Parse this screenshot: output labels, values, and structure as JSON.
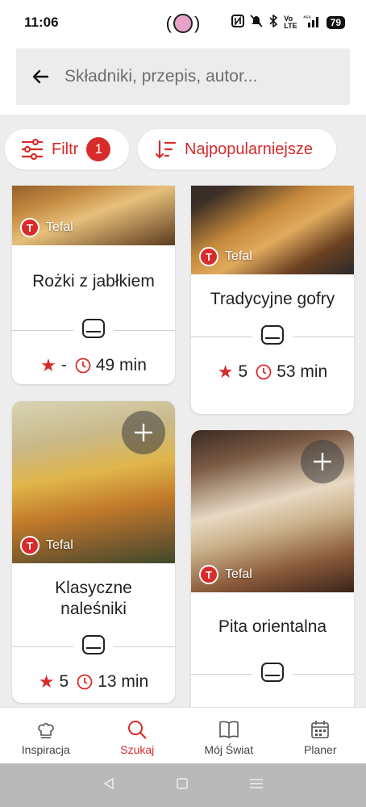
{
  "status": {
    "time": "11:06",
    "battery": "79",
    "network": "⁴⁵⁶"
  },
  "search": {
    "placeholder": "Składniki, przepis, autor..."
  },
  "filters": {
    "filter_label": "Filtr",
    "filter_count": "1",
    "sort_label": "Najpopularniejsze"
  },
  "cards": [
    {
      "brand": "Tefal",
      "title": "Rożki z jabłkiem",
      "rating": "-",
      "time": "49 min"
    },
    {
      "brand": "Tefal",
      "title": "Tradycyjne gofry",
      "rating": "5",
      "time": "53 min"
    },
    {
      "brand": "Tefal",
      "title": "Klasyczne naleśniki",
      "rating": "5",
      "time": "13 min"
    },
    {
      "brand": "Tefal",
      "title": "Pita orientalna",
      "rating": "",
      "time": ""
    }
  ],
  "nav": [
    {
      "label": "Inspiracja",
      "icon": "chef-hat-icon"
    },
    {
      "label": "Szukaj",
      "icon": "search-icon"
    },
    {
      "label": "Mój Świat",
      "icon": "book-icon"
    },
    {
      "label": "Planer",
      "icon": "calendar-icon"
    }
  ],
  "colors": {
    "accent": "#d82b2b"
  }
}
